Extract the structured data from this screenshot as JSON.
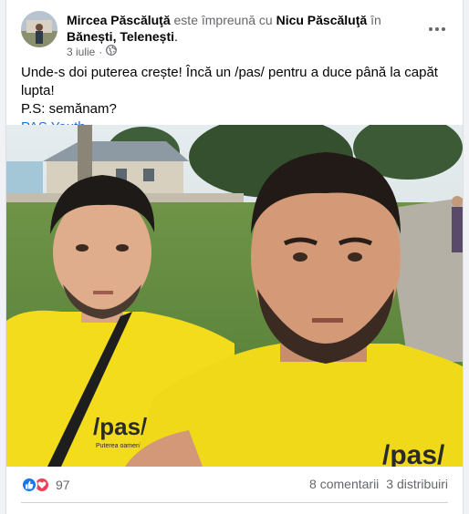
{
  "post": {
    "author": "Mircea Păscăluţă",
    "with_text": "este împreună cu",
    "tagged": "Nicu Păscăluţă",
    "in_text": "în",
    "location": "Bănești, Telenești",
    "location_suffix": ".",
    "date": "3 iulie",
    "dot": "·",
    "privacy_icon": "globe-icon",
    "text_line1": "Unde-s doi puterea crește! Încă un /pas/ pentru a duce până la capăt lupta!",
    "text_line2": "P.S: semănam?",
    "hashtag_link": "PAS Youth",
    "shirt_text_left": "/pas/",
    "shirt_text_right": "/pas/",
    "shirt_small_text": "Puterea oamenilor buni"
  },
  "footer": {
    "reaction_count": "97",
    "comments": "8 comentarii",
    "shares": "3 distribuiri"
  },
  "colors": {
    "link": "#216fdb",
    "like": "#1877f2",
    "love": "#f33e58",
    "shirt": "#f2dc1c"
  }
}
